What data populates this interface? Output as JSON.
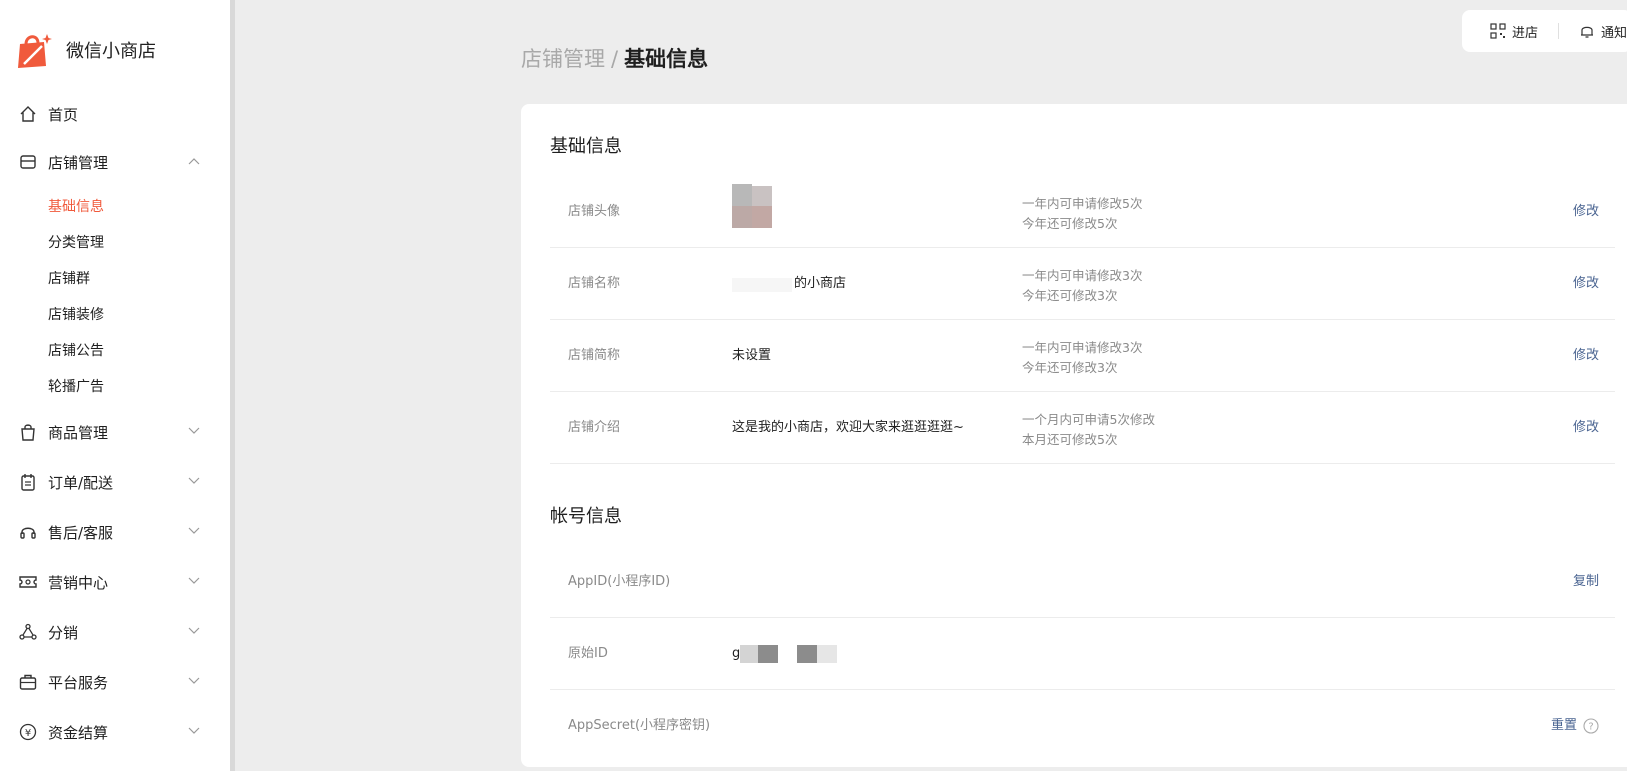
{
  "app": {
    "brand_name": "微信小商店"
  },
  "sidebar": {
    "items": [
      {
        "label": "首页",
        "icon": "home-icon",
        "expandable": false
      },
      {
        "label": "店铺管理",
        "icon": "store-icon",
        "expandable": true,
        "expanded": true
      },
      {
        "label": "商品管理",
        "icon": "bag-icon",
        "expandable": true
      },
      {
        "label": "订单/配送",
        "icon": "clipboard-icon",
        "expandable": true
      },
      {
        "label": "售后/客服",
        "icon": "headset-icon",
        "expandable": true
      },
      {
        "label": "营销中心",
        "icon": "ticket-icon",
        "expandable": true
      },
      {
        "label": "分销",
        "icon": "share-icon",
        "expandable": true
      },
      {
        "label": "平台服务",
        "icon": "briefcase-icon",
        "expandable": true
      },
      {
        "label": "资金结算",
        "icon": "yuan-icon",
        "expandable": true
      }
    ],
    "store_sub_items": [
      {
        "label": "基础信息",
        "active": true
      },
      {
        "label": "分类管理",
        "active": false
      },
      {
        "label": "店铺群",
        "active": false
      },
      {
        "label": "店铺装修",
        "active": false
      },
      {
        "label": "店铺公告",
        "active": false
      },
      {
        "label": "轮播广告",
        "active": false
      }
    ]
  },
  "topbar": {
    "enter_store": "进店",
    "notify": "通知"
  },
  "breadcrumb": {
    "parent": "店铺管理",
    "separator": "/",
    "current": "基础信息"
  },
  "basic_info": {
    "title": "基础信息",
    "rows": [
      {
        "label": "店铺头像",
        "value": "",
        "note1": "一年内可申请修改5次",
        "note2": "今年还可修改5次",
        "action": "修改"
      },
      {
        "label": "店铺名称",
        "value": "的小商店",
        "note1": "一年内可申请修改3次",
        "note2": "今年还可修改3次",
        "action": "修改"
      },
      {
        "label": "店铺简称",
        "value": "未设置",
        "note1": "一年内可申请修改3次",
        "note2": "今年还可修改3次",
        "action": "修改"
      },
      {
        "label": "店铺介绍",
        "value": "这是我的小商店，欢迎大家来逛逛逛逛~",
        "note1": "一个月内可申请5次修改",
        "note2": "本月还可修改5次",
        "action": "修改"
      }
    ]
  },
  "account_info": {
    "title": "帐号信息",
    "rows": [
      {
        "label": "AppID(小程序ID)",
        "value": "",
        "action": "复制"
      },
      {
        "label": "原始ID",
        "value": "g",
        "action": ""
      },
      {
        "label": "AppSecret(小程序密钥)",
        "value": "",
        "action": "重置"
      }
    ]
  },
  "colors": {
    "accent": "#f05a3c",
    "link": "#4a6491",
    "muted": "#8a8a8a"
  }
}
